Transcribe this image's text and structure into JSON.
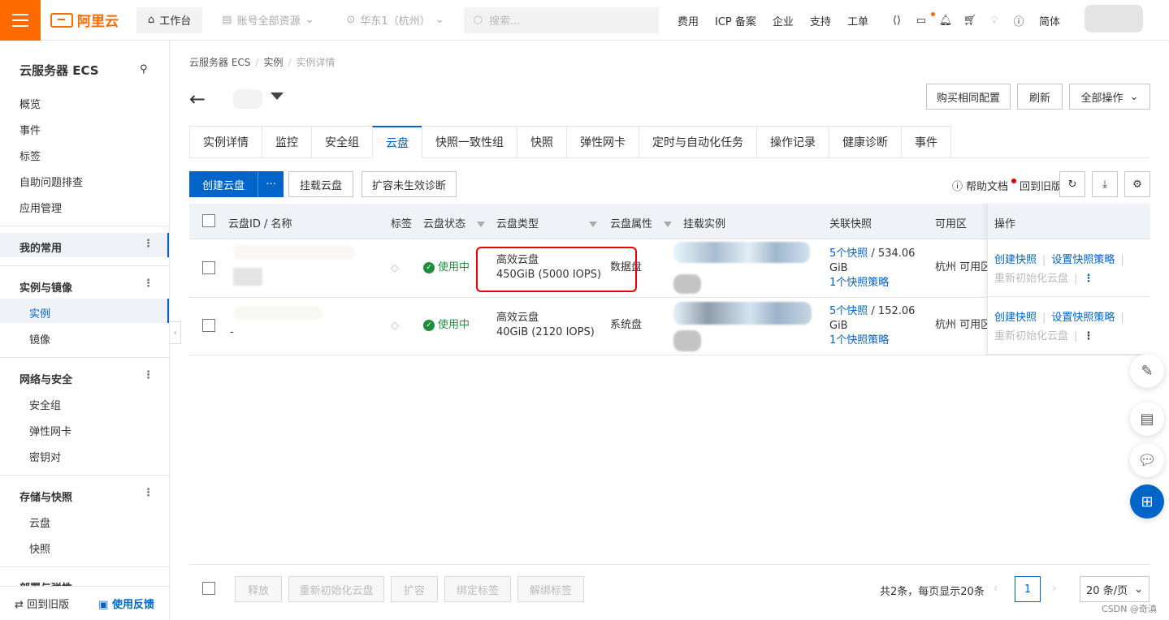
{
  "topbar": {
    "logo": "阿里云",
    "workbench": "工作台",
    "scope": "账号全部资源",
    "region": "华东1（杭州）",
    "search_placeholder": "搜索...",
    "nav": [
      "费用",
      "ICP 备案",
      "企业",
      "支持",
      "工单"
    ],
    "lang": "简体"
  },
  "sidebar": {
    "title": "云服务器 ECS",
    "top_items": [
      "概览",
      "事件",
      "标签",
      "自助问题排查",
      "应用管理"
    ],
    "favorites": "我的常用",
    "groups": [
      {
        "label": "实例与镜像",
        "items": [
          "实例",
          "镜像"
        ]
      },
      {
        "label": "网络与安全",
        "items": [
          "安全组",
          "弹性网卡",
          "密钥对"
        ]
      },
      {
        "label": "存储与快照",
        "items": [
          "云盘",
          "快照"
        ]
      },
      {
        "label": "部署与弹性",
        "items": []
      }
    ],
    "footer_old": "回到旧版",
    "footer_feedback": "使用反馈"
  },
  "breadcrumb": [
    "云服务器 ECS",
    "实例",
    "实例详情"
  ],
  "header_buttons": {
    "buy": "购买相同配置",
    "refresh": "刷新",
    "all_ops": "全部操作"
  },
  "tabs": [
    "实例详情",
    "监控",
    "安全组",
    "云盘",
    "快照一致性组",
    "快照",
    "弹性网卡",
    "定时与自动化任务",
    "操作记录",
    "健康诊断",
    "事件"
  ],
  "toolbar": {
    "create": "创建云盘",
    "more": "···",
    "mount": "挂载云盘",
    "diag": "扩容未生效诊断",
    "help": "帮助文档",
    "old": "回到旧版"
  },
  "table": {
    "headers": {
      "id": "云盘ID / 名称",
      "tag": "标签",
      "status": "云盘状态",
      "type": "云盘类型",
      "attr": "云盘属性",
      "instance": "挂载实例",
      "snap": "关联快照",
      "zone": "可用区",
      "ops": "操作"
    },
    "rows": [
      {
        "name": "",
        "status": "使用中",
        "type": "高效云盘",
        "size": "450GiB (5000 IOPS)",
        "attr": "数据盘",
        "snaps": "5个快照",
        "snap_size": "/ 534.06",
        "unit": "GiB",
        "policy": "1个快照策略",
        "zone": "杭州 可用区I",
        "op1": "创建快照",
        "op2": "设置快照策略",
        "op3": "重新初始化云盘"
      },
      {
        "name": "-",
        "status": "使用中",
        "type": "高效云盘",
        "size": "40GiB (2120 IOPS)",
        "attr": "系统盘",
        "snaps": "5个快照",
        "snap_size": "/ 152.06",
        "unit": "GiB",
        "policy": "1个快照策略",
        "zone": "杭州 可用区I",
        "op1": "创建快照",
        "op2": "设置快照策略",
        "op3": "重新初始化云盘"
      }
    ]
  },
  "footer": {
    "buttons": [
      "释放",
      "重新初始化云盘",
      "扩容",
      "绑定标签",
      "解绑标签"
    ],
    "summary": "共2条，每页显示20条",
    "page": "1",
    "page_size": "20 条/页"
  },
  "watermark": "CSDN @奇滇"
}
